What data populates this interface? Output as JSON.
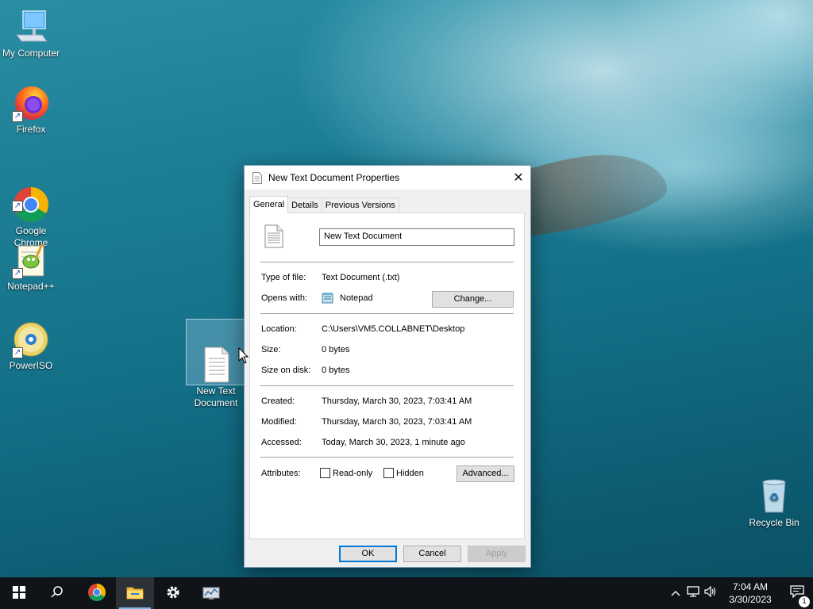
{
  "desktop": {
    "icons": [
      {
        "label": "My Computer"
      },
      {
        "label": "Firefox"
      },
      {
        "label": "Google\nChrome"
      },
      {
        "label": "Notepad++"
      },
      {
        "label": "PowerISO"
      },
      {
        "label": "New Text\nDocument"
      },
      {
        "label": "Recycle Bin"
      }
    ]
  },
  "dialog": {
    "title": "New Text Document Properties",
    "tabs": [
      "General",
      "Details",
      "Previous Versions"
    ],
    "file_name": "New Text Document",
    "type_label": "Type of file:",
    "type_value": "Text Document (.txt)",
    "opens_label": "Opens with:",
    "opens_value": "Notepad",
    "change_button": "Change...",
    "location_label": "Location:",
    "location_value": "C:\\Users\\VM5.COLLABNET\\Desktop",
    "size_label": "Size:",
    "size_value": "0 bytes",
    "size_disk_label": "Size on disk:",
    "size_disk_value": "0 bytes",
    "created_label": "Created:",
    "created_value": "Thursday, March 30, 2023, 7:03:41 AM",
    "modified_label": "Modified:",
    "modified_value": "Thursday, March 30, 2023, 7:03:41 AM",
    "accessed_label": "Accessed:",
    "accessed_value": "Today, March 30, 2023, 1 minute ago",
    "attributes_label": "Attributes:",
    "readonly_label": "Read-only",
    "hidden_label": "Hidden",
    "advanced_button": "Advanced...",
    "ok_button": "OK",
    "cancel_button": "Cancel",
    "apply_button": "Apply"
  },
  "taskbar": {
    "time": "7:04 AM",
    "date": "3/30/2023",
    "notification_count": "1",
    "apps": [
      "start-icon",
      "search-icon",
      "chrome-icon",
      "file-explorer-icon",
      "settings-icon",
      "server-manager-icon"
    ]
  },
  "colors": {
    "accent": "#0078d7",
    "taskbar": "#101418"
  }
}
